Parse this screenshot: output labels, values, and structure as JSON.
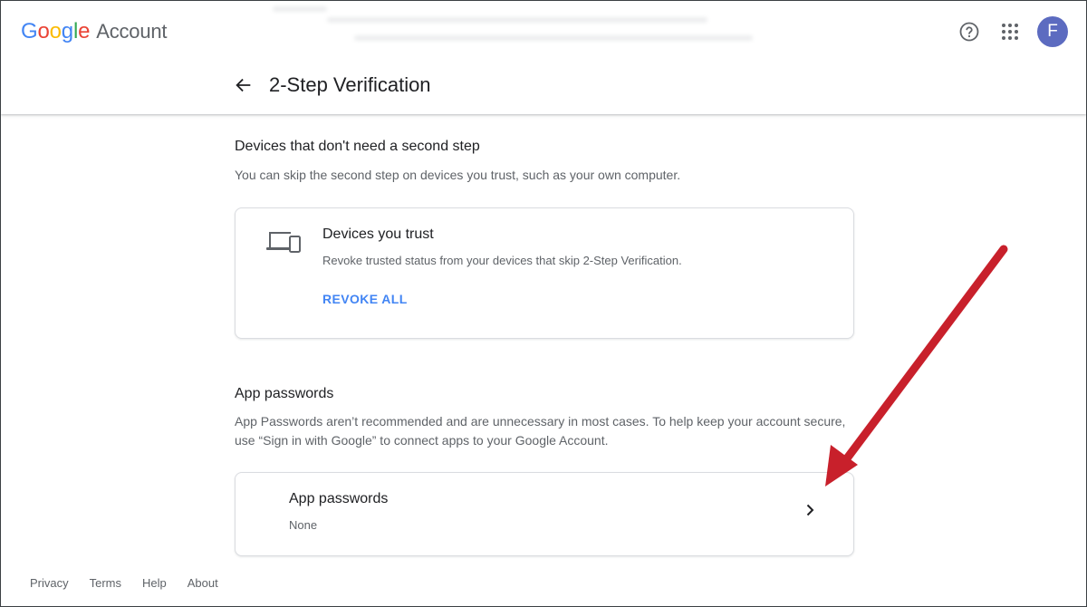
{
  "header": {
    "logo_letters": [
      {
        "char": "G",
        "color": "#4285F4"
      },
      {
        "char": "o",
        "color": "#EA4335"
      },
      {
        "char": "o",
        "color": "#FBBC05"
      },
      {
        "char": "g",
        "color": "#4285F4"
      },
      {
        "char": "l",
        "color": "#34A853"
      },
      {
        "char": "e",
        "color": "#EA4335"
      }
    ],
    "logo_suffix": "Account",
    "help_icon": "help-circle-icon",
    "apps_icon": "apps-grid-icon",
    "avatar_letter": "F",
    "avatar_color": "#5C6BC0"
  },
  "page": {
    "back_icon": "arrow-back-icon",
    "title": "2-Step Verification"
  },
  "devices_section": {
    "title": "Devices that don't need a second step",
    "description": "You can skip the second step on devices you trust, such as your own computer.",
    "card": {
      "icon": "devices-icon",
      "title": "Devices you trust",
      "subtitle": "Revoke trusted status from your devices that skip 2-Step Verification.",
      "action_label": "REVOKE ALL"
    }
  },
  "app_passwords_section": {
    "title": "App passwords",
    "description": "App Passwords aren’t recommended and are unnecessary in most cases. To help keep your account secure, use “Sign in with Google” to connect apps to your Google Account.",
    "card": {
      "title": "App passwords",
      "value": "None",
      "chevron_icon": "chevron-right-icon"
    }
  },
  "footer": {
    "links": [
      "Privacy",
      "Terms",
      "Help",
      "About"
    ]
  },
  "annotation": {
    "arrow_color": "#C8202B"
  }
}
